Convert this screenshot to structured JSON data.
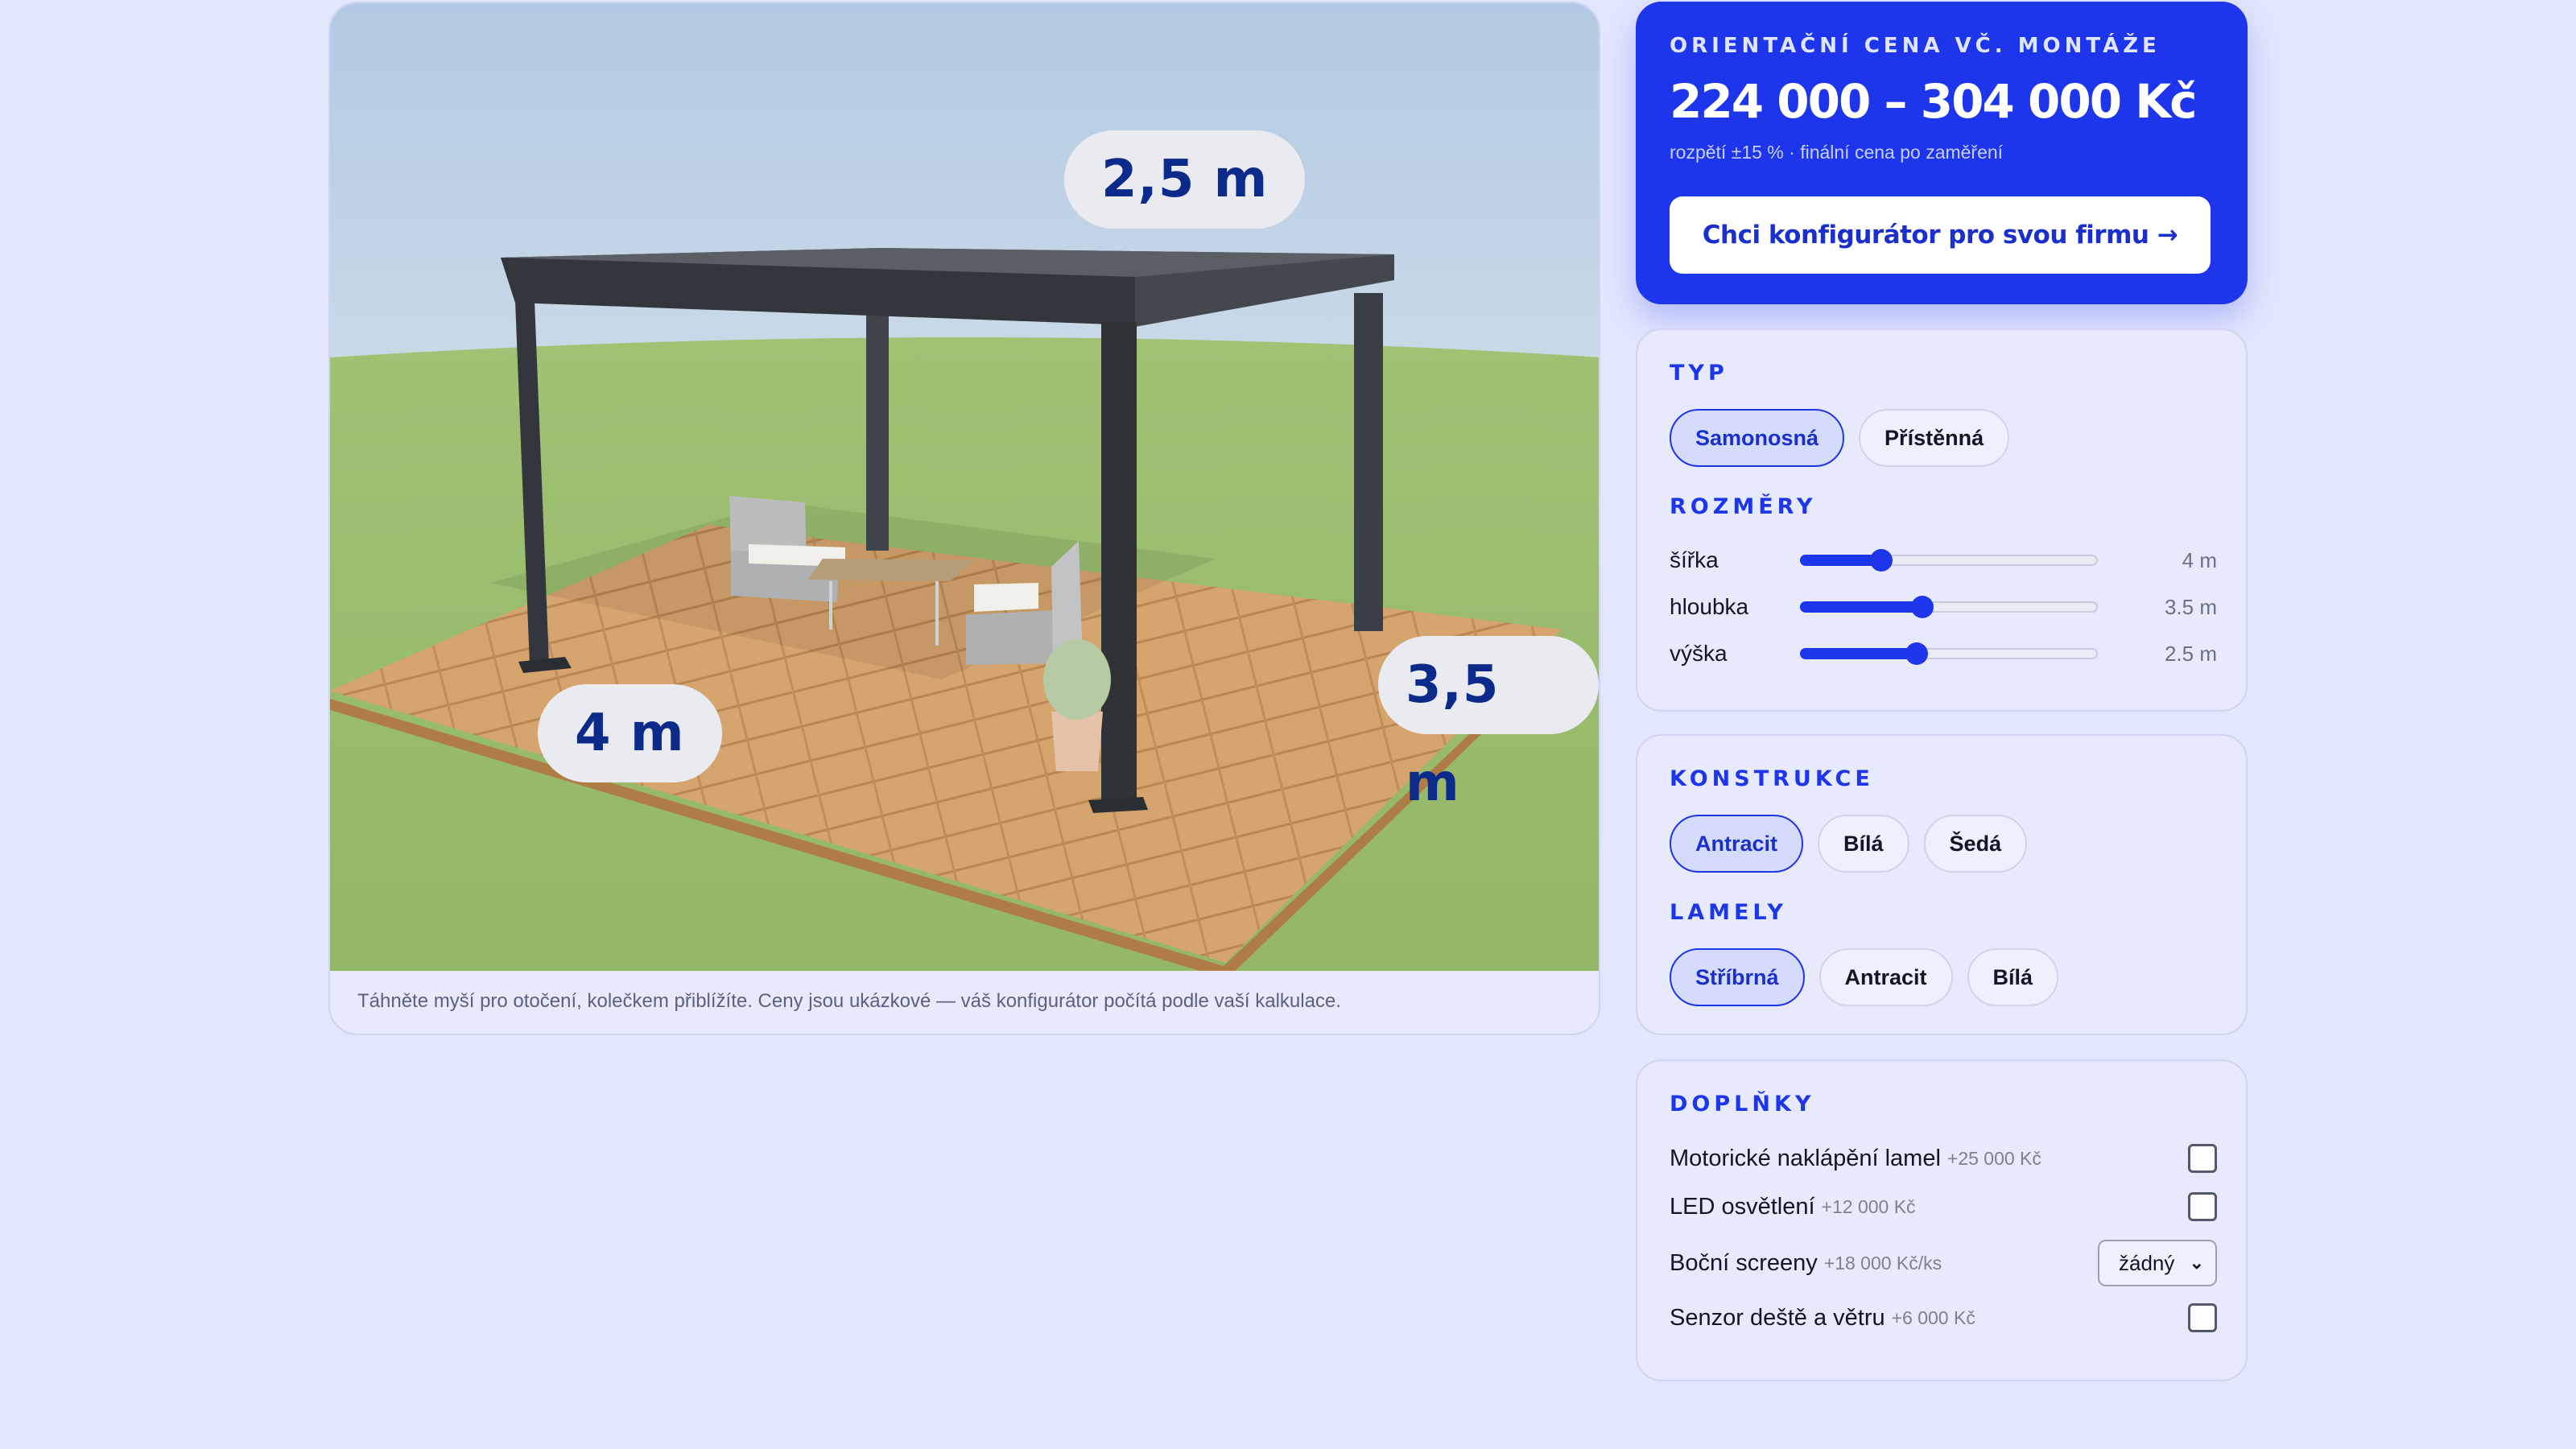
{
  "viewer": {
    "dims": {
      "height": "2,5 m",
      "width": "4 m",
      "depth": "3,5 m"
    },
    "hint": "Táhněte myší pro otočení, kolečkem přiblížíte. Ceny jsou ukázkové — váš konfigurátor počítá podle vaší kalkulace."
  },
  "price": {
    "eyebrow": "ORIENTAČNÍ CENA VČ. MONTÁŽE",
    "value": "224 000 – 304 000 Kč",
    "note": "rozpětí ±15 % · finální cena po zaměření",
    "cta": "Chci konfigurátor pro svou firmu →"
  },
  "typ": {
    "title": "TYP",
    "options": [
      "Samonosná",
      "Přístěnná"
    ],
    "selected": "Samonosná"
  },
  "rozmery": {
    "title": "ROZMĚRY",
    "sliders": [
      {
        "label": "šířka",
        "value": "4 m",
        "level": 0.27
      },
      {
        "label": "hloubka",
        "value": "3.5 m",
        "level": 0.41
      },
      {
        "label": "výška",
        "value": "2.5 m",
        "level": 0.39
      }
    ]
  },
  "konstrukce": {
    "title": "KONSTRUKCE",
    "options": [
      "Antracit",
      "Bílá",
      "Šedá"
    ],
    "selected": "Antracit"
  },
  "lamely": {
    "title": "LAMELY",
    "options": [
      "Stříbrná",
      "Antracit",
      "Bílá"
    ],
    "selected": "Stříbrná"
  },
  "doplnky": {
    "title": "DOPLŇKY",
    "items": [
      {
        "label": "Motorické naklápění lamel",
        "price": "+25 000 Kč",
        "control": "checkbox",
        "checked": false
      },
      {
        "label": "LED osvětlení",
        "price": "+12 000 Kč",
        "control": "checkbox",
        "checked": false
      },
      {
        "label": "Boční screeny",
        "price": "+18 000 Kč/ks",
        "control": "select",
        "selected": "žádný"
      },
      {
        "label": "Senzor deště a větru",
        "price": "+6 000 Kč",
        "control": "checkbox",
        "checked": false
      }
    ]
  },
  "colors": {
    "background": "#e3e7fd",
    "accent": "#1d36ec",
    "frame": "#3a3f47",
    "deck": "#d3a16a",
    "grass": "#9cbd6b",
    "sky": "#b5cce3"
  },
  "icons": [
    "arrow-right-icon",
    "chevron-down-icon"
  ]
}
